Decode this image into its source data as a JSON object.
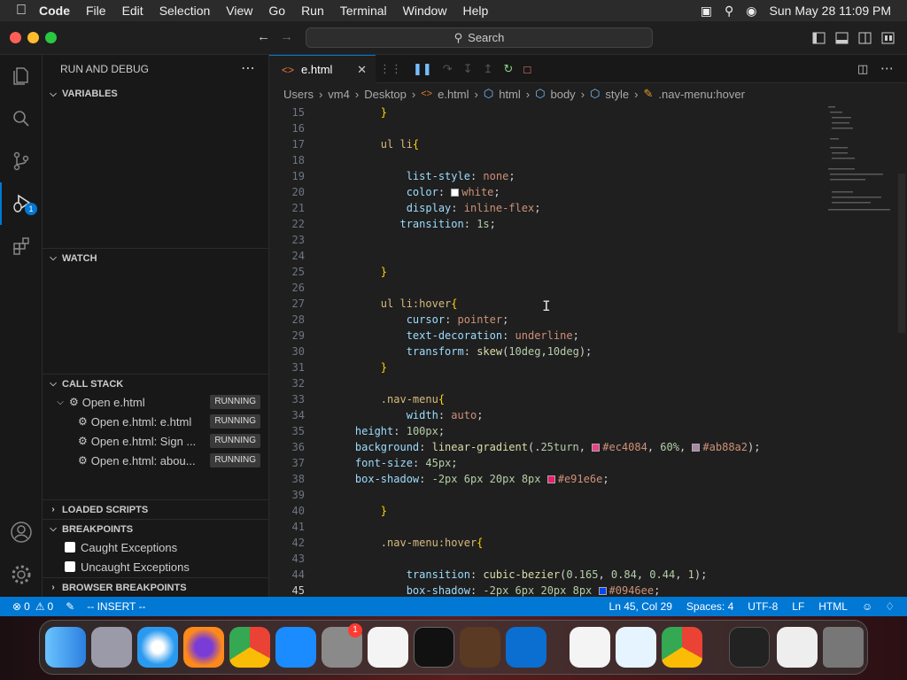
{
  "menubar": {
    "app": "Code",
    "items": [
      "File",
      "Edit",
      "Selection",
      "View",
      "Go",
      "Run",
      "Terminal",
      "Window",
      "Help"
    ],
    "datetime": "Sun May 28  11:09 PM"
  },
  "titlebar": {
    "search": "Search"
  },
  "activity": {
    "debug_badge": "1"
  },
  "sidebar": {
    "title": "RUN AND DEBUG",
    "variables": "VARIABLES",
    "watch": "WATCH",
    "callstack": "CALL STACK",
    "callstack_items": [
      {
        "label": "Open e.html",
        "status": "RUNNING"
      },
      {
        "label": "Open e.html: e.html",
        "status": "RUNNING"
      },
      {
        "label": "Open e.html: Sign ...",
        "status": "RUNNING"
      },
      {
        "label": "Open e.html: abou...",
        "status": "RUNNING"
      }
    ],
    "loaded": "LOADED SCRIPTS",
    "breakpoints": "BREAKPOINTS",
    "bp_items": [
      "Caught Exceptions",
      "Uncaught Exceptions"
    ],
    "browser_bp": "BROWSER BREAKPOINTS"
  },
  "editor": {
    "tab": "e.html",
    "breadcrumb": [
      "Users",
      "vm4",
      "Desktop",
      "e.html",
      "html",
      "body",
      "style",
      ".nav-menu:hover"
    ]
  },
  "code": [
    {
      "n": "15",
      "t": "        }"
    },
    {
      "n": "16",
      "t": ""
    },
    {
      "n": "17",
      "t": "        ul li{"
    },
    {
      "n": "18",
      "t": ""
    },
    {
      "n": "19",
      "t": "            list-style: none;"
    },
    {
      "n": "20",
      "t": "            color: white;"
    },
    {
      "n": "21",
      "t": "            display: inline-flex;"
    },
    {
      "n": "22",
      "t": "           transition: 1s;"
    },
    {
      "n": "23",
      "t": ""
    },
    {
      "n": "24",
      "t": ""
    },
    {
      "n": "25",
      "t": "        }"
    },
    {
      "n": "26",
      "t": ""
    },
    {
      "n": "27",
      "t": "        ul li:hover{"
    },
    {
      "n": "28",
      "t": "            cursor: pointer;"
    },
    {
      "n": "29",
      "t": "            text-decoration: underline;"
    },
    {
      "n": "30",
      "t": "            transform: skew(10deg,10deg);"
    },
    {
      "n": "31",
      "t": "        }"
    },
    {
      "n": "32",
      "t": ""
    },
    {
      "n": "33",
      "t": "        .nav-menu{"
    },
    {
      "n": "34",
      "t": "            width: auto;"
    },
    {
      "n": "35",
      "t": "    height: 100px;"
    },
    {
      "n": "36",
      "t": "    background: linear-gradient(.25turn, #ec4084, 60%, #ab88a2);"
    },
    {
      "n": "37",
      "t": "    font-size: 45px;"
    },
    {
      "n": "38",
      "t": "    box-shadow: -2px 6px 20px 8px #e91e6e;"
    },
    {
      "n": "39",
      "t": ""
    },
    {
      "n": "40",
      "t": "        }"
    },
    {
      "n": "41",
      "t": ""
    },
    {
      "n": "42",
      "t": "        .nav-menu:hover{"
    },
    {
      "n": "43",
      "t": ""
    },
    {
      "n": "44",
      "t": "            transition: cubic-bezier(0.165, 0.84, 0.44, 1);"
    },
    {
      "n": "45",
      "t": "            box-shadow: -2px 6px 20px 8px #0946ee;"
    }
  ],
  "colors": {
    "c20": "#ffffff",
    "c36a": "#ec4084",
    "c36b": "#ab88a2",
    "c38": "#e91e6e",
    "c45": "#0946ee",
    "accent": "#0078d4"
  },
  "status": {
    "errors": "0",
    "warnings": "0",
    "mode": "-- INSERT --",
    "position": "Ln 45, Col 29",
    "spaces": "Spaces: 4",
    "encoding": "UTF-8",
    "eol": "LF",
    "language": "HTML"
  },
  "dock": {
    "badge": "1"
  }
}
